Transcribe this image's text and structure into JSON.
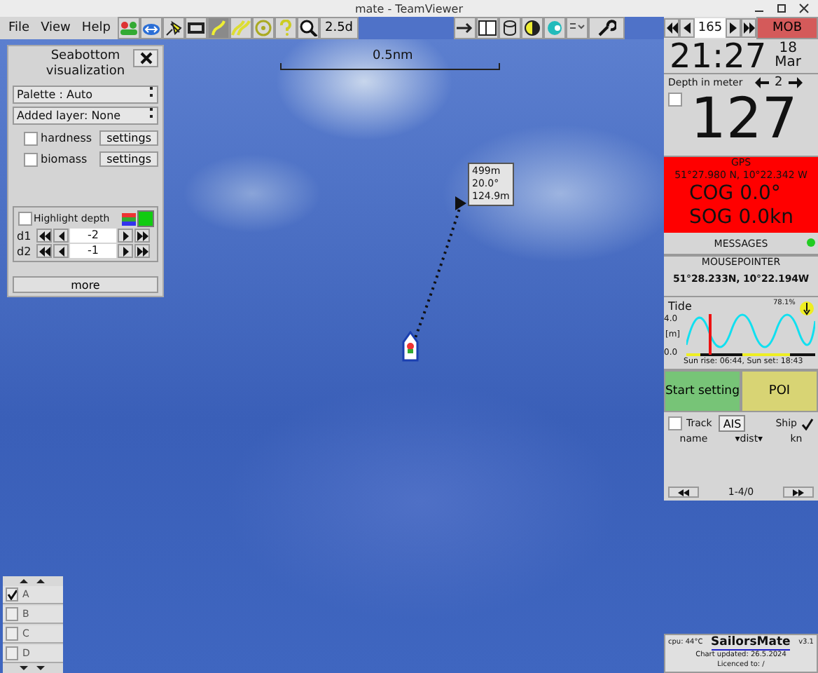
{
  "window": {
    "title": "mate - TeamViewer"
  },
  "menu": [
    "File",
    "View",
    "Help"
  ],
  "toolbar": {
    "zoom_label": "2.5d",
    "page": "165",
    "mob": "MOB"
  },
  "map": {
    "scale": "0.5nm",
    "waypoint_info": [
      "499m",
      "20.0°",
      "124.9m"
    ]
  },
  "seabottom_panel": {
    "title": "Seabottom visualization",
    "palette": "Palette : Auto",
    "layer": "Added layer: None",
    "layers": [
      {
        "label": "hardness",
        "checked": false,
        "button": "settings"
      },
      {
        "label": "biomass",
        "checked": false,
        "button": "settings"
      }
    ],
    "highlight": {
      "label": "Highlight depth",
      "checked": false,
      "on": true,
      "depths": [
        {
          "label": "d1",
          "value": "-2"
        },
        {
          "label": "d2",
          "value": "-1"
        }
      ]
    },
    "more": "more"
  },
  "layer_list": [
    {
      "label": "A",
      "checked": true
    },
    {
      "label": "B",
      "checked": false
    },
    {
      "label": "C",
      "checked": false
    },
    {
      "label": "D",
      "checked": false
    }
  ],
  "sidebar": {
    "time": "21:27",
    "day": "18",
    "month": "Mar",
    "depth_label": "Depth in meter",
    "depth_page": "2",
    "depth_checked": false,
    "depth": "127",
    "gps": {
      "label": "GPS",
      "position": "51°27.980 N, 10°22.342 W",
      "cog": "COG 0.0°",
      "sog": "SOG 0.0kn"
    },
    "messages": "MESSAGES",
    "pointer_label": "MOUSEPOINTER",
    "pointer": "51°28.233N, 10°22.194W",
    "tide": {
      "title": "Tide",
      "percent": "78.1%",
      "ymax": "4.0",
      "unit": "[m]",
      "ymin": "0.0",
      "sun": "Sun rise: 06:44, Sun set: 18:43"
    },
    "start": "Start setting",
    "poi": "POI",
    "ais": {
      "track": "Track",
      "track_checked": false,
      "tab": "AIS",
      "ship": "Ship",
      "ship_checked": true,
      "col_name": "name",
      "col_dist": "▾dist▾",
      "col_kn": "kn",
      "pager": "1-4/0"
    }
  },
  "info": {
    "cpu": "cpu: 44°C",
    "app": "SailorsMate",
    "version": "v3.1",
    "updated": "Chart updated: 26.5.2024",
    "licence": "Licenced to: /"
  }
}
